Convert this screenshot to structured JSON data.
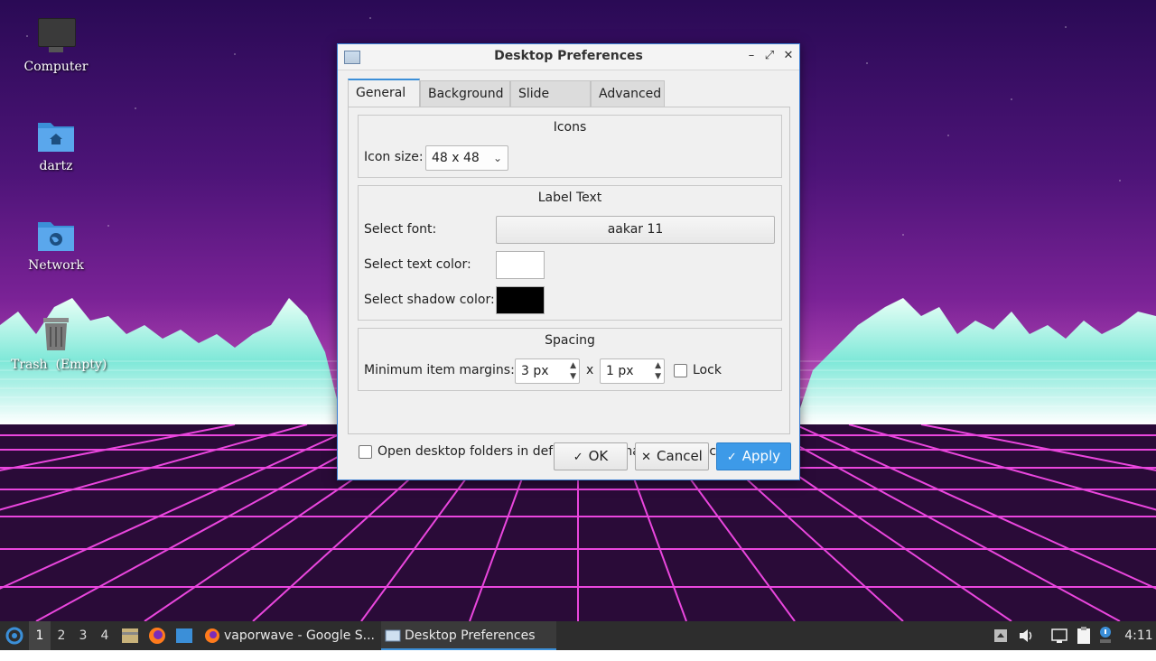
{
  "desktop": {
    "icons": [
      {
        "label": "Computer",
        "icon": "computer-icon"
      },
      {
        "label": "dartz",
        "icon": "home-folder-icon"
      },
      {
        "label": "Network",
        "icon": "network-folder-icon"
      },
      {
        "label": "Trash  (Empty)",
        "icon": "trash-icon"
      }
    ]
  },
  "window": {
    "title": "Desktop Preferences",
    "controls": {
      "minimize": "–",
      "maximize": "⤢",
      "close": "✕"
    },
    "tabs": [
      {
        "label": "General",
        "active": true
      },
      {
        "label": "Background",
        "active": false
      },
      {
        "label": "Slide Show",
        "active": false
      },
      {
        "label": "Advanced",
        "active": false
      }
    ],
    "icons_group": {
      "title": "Icons",
      "icon_size_label": "Icon size:",
      "icon_size_value": "48 x 48"
    },
    "label_group": {
      "title": "Label Text",
      "font_label": "Select font:",
      "font_value": "aakar 11",
      "text_color_label": "Select text color:",
      "text_color": "#ffffff",
      "shadow_color_label": "Select shadow color:",
      "shadow_color": "#000000"
    },
    "spacing_group": {
      "title": "Spacing",
      "margins_label": "Minimum item margins:",
      "margin_x": "3 px",
      "separator": "x",
      "margin_y": "1 px",
      "lock_label": "Lock",
      "lock_checked": false
    },
    "open_folders_label": "Open desktop folders in default file manager by left clicking",
    "open_folders_checked": false,
    "buttons": {
      "ok": "OK",
      "cancel": "Cancel",
      "apply": "Apply"
    }
  },
  "taskbar": {
    "workspaces": [
      "1",
      "2",
      "3",
      "4"
    ],
    "active_workspace": "1",
    "tasks": [
      {
        "label": "vaporwave - Google S...",
        "icon": "firefox-icon",
        "active": false
      },
      {
        "label": "Desktop Preferences",
        "icon": "window-icon",
        "active": true
      }
    ],
    "clock": "4:11"
  },
  "colors": {
    "accent": "#3b8fd8",
    "taskbar": "#2d2d2d"
  }
}
